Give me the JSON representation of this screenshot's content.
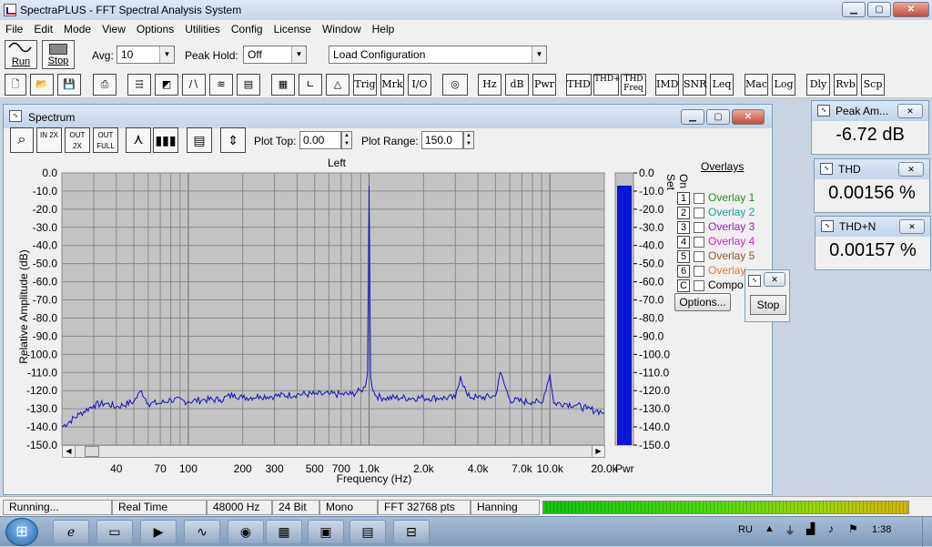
{
  "window": {
    "title": "SpectraPLUS - FFT Spectral Analysis System"
  },
  "menu": [
    "File",
    "Edit",
    "Mode",
    "View",
    "Options",
    "Utilities",
    "Config",
    "License",
    "Window",
    "Help"
  ],
  "toolbar": {
    "run_label": "Run",
    "stop_label": "Stop",
    "avg_label": "Avg:",
    "avg_value": "10",
    "peak_hold_label": "Peak Hold:",
    "peak_hold_value": "Off",
    "config_value": "Load Configuration",
    "buttons": [
      "Trig",
      "Mrk",
      "I/O",
      "Hz",
      "dB",
      "Pwr",
      "THD",
      "THD+N",
      "THD Freq",
      "IMD",
      "SNR",
      "Leq",
      "Mac",
      "Log",
      "Dly",
      "Rvb",
      "Scp"
    ]
  },
  "spectrum": {
    "title": "Spectrum",
    "zoom_in": "IN 2X",
    "zoom_out": "OUT 2X",
    "zoom_full": "OUT FULL",
    "plot_top_label": "Plot Top:",
    "plot_top_value": "0.00",
    "plot_range_label": "Plot Range:",
    "plot_range_value": "150.0",
    "channel": "Left",
    "pwr_label": "Pwr",
    "options_button": "Options...",
    "set_label": "Set",
    "on_label": "On",
    "overlays_title": "Overlays",
    "overlays": [
      {
        "num": "1",
        "label": "Overlay 1",
        "color": "#2e8b2e"
      },
      {
        "num": "2",
        "label": "Overlay 2",
        "color": "#1aa3a3"
      },
      {
        "num": "3",
        "label": "Overlay 3",
        "color": "#9b1fb5"
      },
      {
        "num": "4",
        "label": "Overlay 4",
        "color": "#d01fd0"
      },
      {
        "num": "5",
        "label": "Overlay 5",
        "color": "#8b5a2b"
      },
      {
        "num": "6",
        "label": "Overlay",
        "color": "#e07b3a"
      },
      {
        "num": "C",
        "label": "Compo",
        "color": "#000000"
      }
    ]
  },
  "stop_popup": {
    "button": "Stop"
  },
  "meters": [
    {
      "title": "Peak Am...",
      "value": "-6.72 dB"
    },
    {
      "title": "THD",
      "value": "0.00156 %"
    },
    {
      "title": "THD+N",
      "value": "0.00157 %"
    }
  ],
  "status": {
    "state": "Running...",
    "mode": "Real Time",
    "rate": "48000 Hz",
    "bits": "24 Bit",
    "channels": "Mono",
    "fft": "FFT 32768 pts",
    "window": "Hanning"
  },
  "taskbar": {
    "lang": "RU",
    "time": "1:38"
  },
  "chart_data": {
    "type": "line",
    "title": "Left",
    "xlabel": "Frequency (Hz)",
    "ylabel": "Relative Amplitude (dB)",
    "x_scale": "log",
    "xlim": [
      20,
      20000
    ],
    "ylim": [
      -150,
      0
    ],
    "x_ticks": [
      "40",
      "70",
      "100",
      "200",
      "300",
      "500",
      "700",
      "1.0k",
      "2.0k",
      "4.0k",
      "7.0k",
      "10.0k",
      "20.0k"
    ],
    "y_ticks": [
      "0.0",
      "-10.0",
      "-20.0",
      "-30.0",
      "-40.0",
      "-50.0",
      "-60.0",
      "-70.0",
      "-80.0",
      "-90.0",
      "-100.0",
      "-110.0",
      "-120.0",
      "-130.0",
      "-140.0",
      "-150.0"
    ],
    "series": [
      {
        "color": "#1010c0",
        "x": [
          20,
          25,
          30,
          35,
          40,
          50,
          55,
          60,
          70,
          80,
          100,
          120,
          150,
          180,
          200,
          250,
          300,
          400,
          500,
          600,
          700,
          800,
          900,
          950,
          980,
          1000,
          1020,
          1050,
          1100,
          1200,
          1500,
          2000,
          2500,
          3000,
          3200,
          3500,
          4000,
          5000,
          5300,
          6000,
          7000,
          8000,
          9000,
          10000,
          10500,
          12000,
          14000,
          16000,
          18000,
          20000
        ],
        "y": [
          -140,
          -133,
          -128,
          -127,
          -129,
          -126,
          -120,
          -127,
          -127,
          -125,
          -126,
          -125,
          -125,
          -122,
          -124,
          -123,
          -123,
          -122,
          -122,
          -122,
          -122,
          -122,
          -120,
          -118,
          -110,
          -7,
          -112,
          -120,
          -123,
          -124,
          -124,
          -124,
          -124,
          -124,
          -112,
          -123,
          -124,
          -123,
          -110,
          -125,
          -126,
          -126,
          -127,
          -111,
          -127,
          -127,
          -128,
          -130,
          -131,
          -132
        ]
      }
    ],
    "pwr_bar": {
      "value": -7,
      "color": "#0a16d8"
    },
    "pwr_ticks": [
      "0.0",
      "-10.0",
      "-20.0",
      "-30.0",
      "-40.0",
      "-50.0",
      "-60.0",
      "-70.0",
      "-80.0",
      "-90.0",
      "-100.0",
      "-110.0",
      "-120.0",
      "-130.0",
      "-140.0",
      "-150.0"
    ]
  }
}
